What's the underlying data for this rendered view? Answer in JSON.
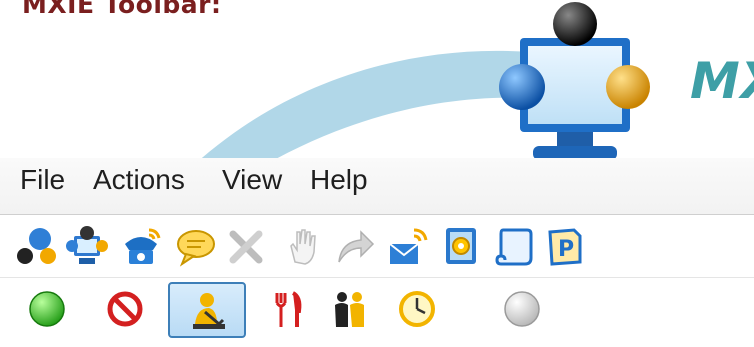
{
  "header": {
    "title": "MXIE Toolbar:"
  },
  "brand": {
    "text": "MX"
  },
  "menu": {
    "items": [
      "File",
      "Actions",
      "View",
      "Help"
    ]
  },
  "toolbar": {
    "action_icons": [
      "add-contact-icon",
      "conference-icon",
      "phone-icon",
      "chat-icon",
      "disconnect-icon",
      "hold-icon",
      "transfer-icon",
      "email-icon",
      "voicemail-icon",
      "scroll-icon",
      "park-icon"
    ],
    "status_icons": [
      "available-icon",
      "do-not-disturb-icon",
      "away-icon",
      "lunch-icon",
      "meeting-icon",
      "out-of-office-icon",
      "offline-icon"
    ],
    "selected_status": "away-icon"
  },
  "colors": {
    "title": "#7a1f1f",
    "brand": "#3e9fa6",
    "accent": "#3d7fb8"
  }
}
